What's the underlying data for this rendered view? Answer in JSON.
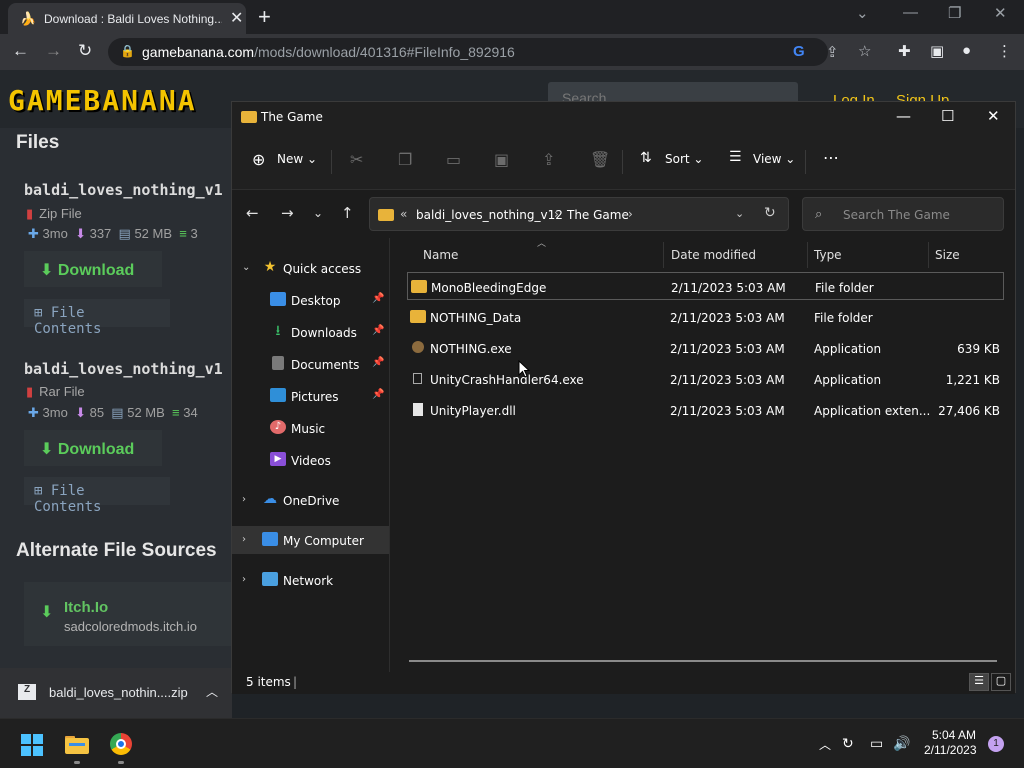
{
  "browser": {
    "tab_title": "Download : Baldi Loves Nothing...",
    "url_domain": "gamebanana.com",
    "url_path": "/mods/download/401316#FileInfo_892916"
  },
  "page": {
    "logo": "GAMEBANANA",
    "search_placeholder": "Search",
    "login": "Log In",
    "signup": "Sign Up",
    "files_heading": "Files",
    "files": [
      {
        "name": "baldi_loves_nothing_v1",
        "type": "Zip File",
        "age": "3mo",
        "downloads": "337",
        "size": "52 MB",
        "extra": "3",
        "download_label": "Download",
        "contents_label": "File Contents"
      },
      {
        "name": "baldi_loves_nothing_v1",
        "type": "Rar File",
        "age": "3mo",
        "downloads": "85",
        "size": "52 MB",
        "extra": "34",
        "download_label": "Download",
        "contents_label": "File Contents"
      }
    ],
    "alt_heading": "Alternate File Sources",
    "alt_source": {
      "name": "Itch.Io",
      "url": "sadcoloredmods.itch.io"
    }
  },
  "download_shelf": {
    "file": "baldi_loves_nothin....zip"
  },
  "explorer": {
    "title": "The Game",
    "toolbar": {
      "new": "New",
      "sort": "Sort",
      "view": "View"
    },
    "breadcrumb": [
      "baldi_loves_nothing_v12",
      "The Game"
    ],
    "search_placeholder": "Search The Game",
    "nav": {
      "quick_access": "Quick access",
      "desktop": "Desktop",
      "downloads": "Downloads",
      "documents": "Documents",
      "pictures": "Pictures",
      "music": "Music",
      "videos": "Videos",
      "onedrive": "OneDrive",
      "my_computer": "My Computer",
      "network": "Network"
    },
    "columns": {
      "name": "Name",
      "date": "Date modified",
      "type": "Type",
      "size": "Size"
    },
    "rows": [
      {
        "name": "MonoBleedingEdge",
        "date": "2/11/2023 5:03 AM",
        "type": "File folder",
        "size": ""
      },
      {
        "name": "NOTHING_Data",
        "date": "2/11/2023 5:03 AM",
        "type": "File folder",
        "size": ""
      },
      {
        "name": "NOTHING.exe",
        "date": "2/11/2023 5:03 AM",
        "type": "Application",
        "size": "639 KB"
      },
      {
        "name": "UnityCrashHandler64.exe",
        "date": "2/11/2023 5:03 AM",
        "type": "Application",
        "size": "1,221 KB"
      },
      {
        "name": "UnityPlayer.dll",
        "date": "2/11/2023 5:03 AM",
        "type": "Application exten...",
        "size": "27,406 KB"
      }
    ],
    "status": "5 items"
  },
  "taskbar": {
    "time": "5:04 AM",
    "date": "2/11/2023",
    "notifications": "1"
  }
}
